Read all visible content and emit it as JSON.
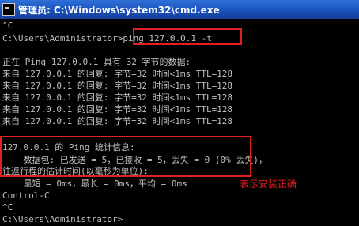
{
  "window": {
    "title": "管理员: C:\\Windows\\system32\\cmd.exe"
  },
  "console": {
    "lines": [
      "^C",
      "C:\\Users\\Administrator>ping 127.0.0.1 -t",
      "",
      "正在 Ping 127.0.0.1 具有 32 字节的数据:",
      "来自 127.0.0.1 的回复: 字节=32 时间<1ms TTL=128",
      "来自 127.0.0.1 的回复: 字节=32 时间<1ms TTL=128",
      "来自 127.0.0.1 的回复: 字节=32 时间<1ms TTL=128",
      "来自 127.0.0.1 的回复: 字节=32 时间<1ms TTL=128",
      "来自 127.0.0.1 的回复: 字节=32 时间<1ms TTL=128",
      "",
      "127.0.0.1 的 Ping 统计信息:",
      "    数据包: 已发送 = 5，已接收 = 5，丢失 = 0 (0% 丢失)，",
      "往返行程的估计时间(以毫秒为单位):",
      "    最短 = 0ms，最长 = 0ms，平均 = 0ms",
      "Control-C",
      "^C",
      "C:\\Users\\Administrator>"
    ]
  },
  "annotation": {
    "text": "表示安装正确",
    "color": "#e32020"
  }
}
